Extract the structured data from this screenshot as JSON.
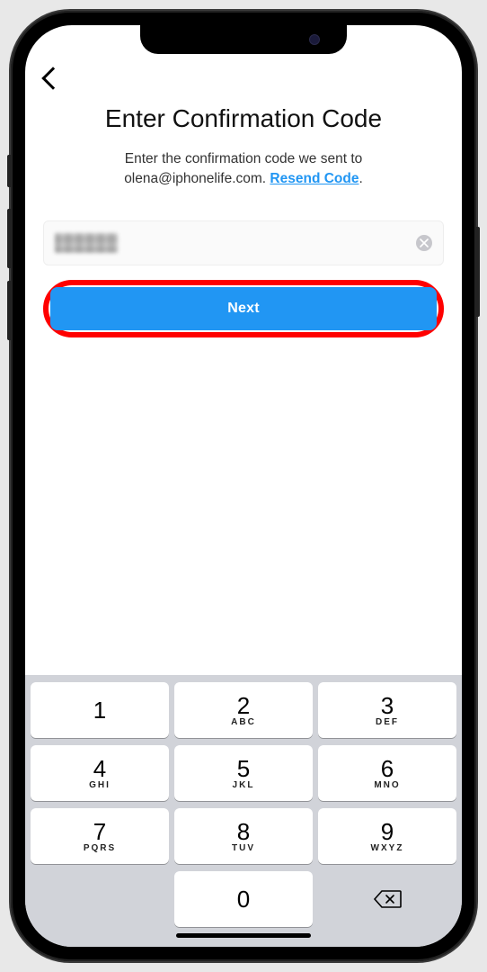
{
  "page": {
    "title": "Enter Confirmation Code",
    "subtitle_prefix": "Enter the confirmation code we sent to ",
    "email": "olena@iphonelife.com",
    "subtitle_suffix": ". ",
    "resend_label": "Resend Code",
    "subtitle_end": "."
  },
  "input": {
    "value_redacted": true,
    "clear_icon": "clear-icon"
  },
  "buttons": {
    "next_label": "Next"
  },
  "keypad": {
    "rows": [
      [
        {
          "d": "1",
          "l": ""
        },
        {
          "d": "2",
          "l": "ABC"
        },
        {
          "d": "3",
          "l": "DEF"
        }
      ],
      [
        {
          "d": "4",
          "l": "GHI"
        },
        {
          "d": "5",
          "l": "JKL"
        },
        {
          "d": "6",
          "l": "MNO"
        }
      ],
      [
        {
          "d": "7",
          "l": "PQRS"
        },
        {
          "d": "8",
          "l": "TUV"
        },
        {
          "d": "9",
          "l": "WXYZ"
        }
      ],
      [
        {
          "blank": true
        },
        {
          "d": "0",
          "l": ""
        },
        {
          "delete": true
        }
      ]
    ]
  },
  "colors": {
    "accent": "#2196f3",
    "highlight_ring": "#ff0000"
  }
}
